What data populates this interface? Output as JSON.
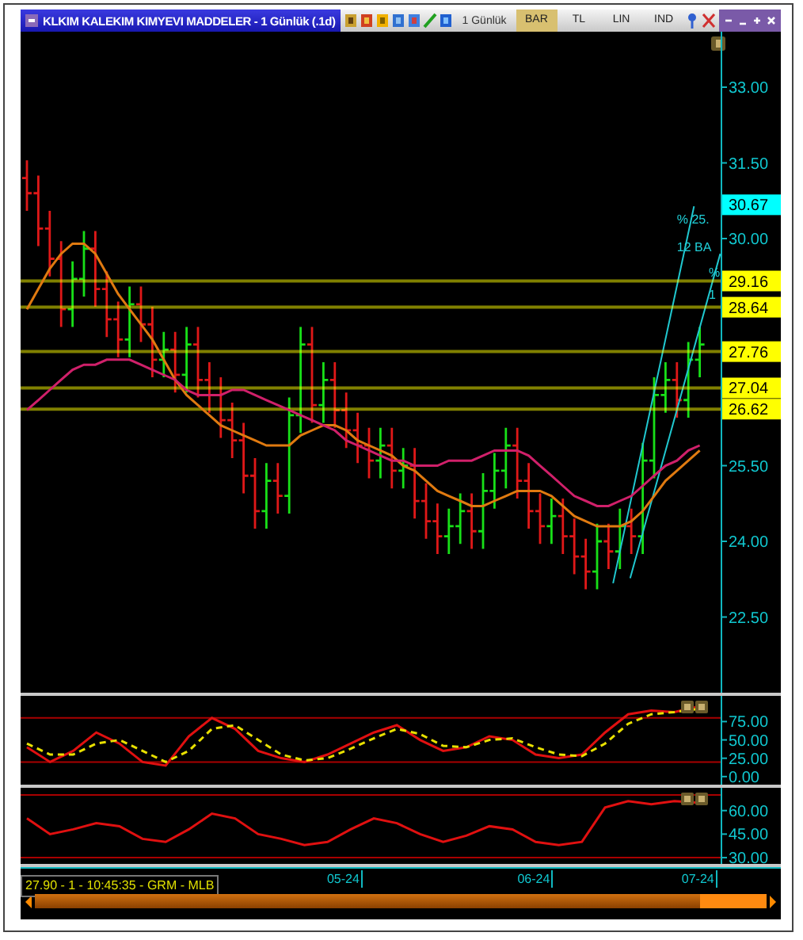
{
  "window": {
    "title": "KLKIM KALEKIM KIMYEVI MADDELER - 1 Günlük (.1d)"
  },
  "toolbar": {
    "period": "1 Günlük",
    "tabs": [
      {
        "label": "BAR",
        "selected": true
      },
      {
        "label": "TL",
        "selected": false
      },
      {
        "label": "LIN",
        "selected": false
      },
      {
        "label": "IND",
        "selected": false
      }
    ]
  },
  "price_panel": {
    "price_tag": "30.67",
    "chart_data": {
      "type": "line",
      "ylim": [
        21,
        34.1
      ],
      "yticks": [
        {
          "value": 22.5,
          "label": "22.50"
        },
        {
          "value": 24,
          "label": "24.00"
        },
        {
          "value": 25.5,
          "label": "25.50"
        },
        {
          "value": 30,
          "label": "30.00"
        },
        {
          "value": 31.5,
          "label": "31.50"
        },
        {
          "value": 33,
          "label": "33.00"
        }
      ],
      "series": [
        {
          "color": "#e07a10",
          "values": [
            28.6,
            29.0,
            29.4,
            29.7,
            29.9,
            29.9,
            29.7,
            29.3,
            28.9,
            28.6,
            28.3,
            28.0,
            27.6,
            27.2,
            26.9,
            26.7,
            26.5,
            26.3,
            26.2,
            26.1,
            26.0,
            25.9,
            25.9,
            25.9,
            26.1,
            26.2,
            26.3,
            26.3,
            26.2,
            26.0,
            25.9,
            25.8,
            25.7,
            25.5,
            25.4,
            25.2,
            25.0,
            24.9,
            24.8,
            24.7,
            24.7,
            24.8,
            24.9,
            25.0,
            25.0,
            25.0,
            24.9,
            24.7,
            24.5,
            24.4,
            24.3,
            24.3,
            24.3,
            24.4,
            24.6,
            24.9,
            25.2,
            25.4,
            25.6,
            25.8
          ]
        },
        {
          "color": "#d0206a",
          "values": [
            26.6,
            26.8,
            27.0,
            27.2,
            27.4,
            27.5,
            27.5,
            27.6,
            27.6,
            27.6,
            27.5,
            27.4,
            27.3,
            27.2,
            27.0,
            26.9,
            26.9,
            26.9,
            27.0,
            27.0,
            26.9,
            26.8,
            26.7,
            26.6,
            26.5,
            26.4,
            26.3,
            26.2,
            26.0,
            25.9,
            25.8,
            25.7,
            25.6,
            25.6,
            25.5,
            25.5,
            25.5,
            25.6,
            25.6,
            25.6,
            25.7,
            25.8,
            25.8,
            25.8,
            25.7,
            25.5,
            25.3,
            25.1,
            24.9,
            24.8,
            24.7,
            24.7,
            24.8,
            24.9,
            25.1,
            25.3,
            25.5,
            25.6,
            25.8,
            25.9
          ]
        }
      ],
      "ref_lines": [
        {
          "axis": "y",
          "value": 29.16,
          "label": "29.16",
          "color": "#ffff00"
        },
        {
          "axis": "y",
          "value": 28.64,
          "label": "28.64",
          "color": "#ffff00"
        },
        {
          "axis": "y",
          "value": 27.76,
          "label": "27.76",
          "color": "#ffff00"
        },
        {
          "axis": "y",
          "value": 27.04,
          "label": "27.04",
          "color": "#ffff00"
        },
        {
          "axis": "y",
          "value": 26.62,
          "label": "26.62",
          "color": "#ffff00"
        }
      ],
      "annotations": [
        "% 25.",
        "12 BA",
        "%",
        "1"
      ]
    }
  },
  "stochastic_panel": {
    "chart_data": {
      "type": "line",
      "ylim": [
        -11,
        110
      ],
      "yticks": [
        {
          "value": 0,
          "label": "0.00"
        },
        {
          "value": 25,
          "label": "25.00"
        },
        {
          "value": 50,
          "label": "50.00"
        },
        {
          "value": 75,
          "label": "75.00"
        }
      ],
      "series": [
        {
          "color": "#e01010",
          "values": [
            40,
            20,
            35,
            60,
            45,
            20,
            15,
            55,
            80,
            65,
            35,
            25,
            20,
            30,
            45,
            60,
            70,
            50,
            35,
            40,
            55,
            50,
            30,
            25,
            30,
            60,
            85,
            90,
            88,
            95
          ]
        },
        {
          "color": "#e8e000",
          "line_style": "dashed",
          "values": [
            45,
            30,
            30,
            45,
            50,
            35,
            20,
            35,
            65,
            70,
            50,
            30,
            22,
            25,
            38,
            52,
            65,
            58,
            42,
            40,
            50,
            52,
            40,
            30,
            28,
            45,
            72,
            85,
            88,
            92
          ]
        }
      ],
      "ref_lines": [
        {
          "axis": "y",
          "value": 80,
          "color": "#a80000"
        },
        {
          "axis": "y",
          "value": 20,
          "color": "#a80000"
        }
      ]
    }
  },
  "rsi_panel": {
    "chart_data": {
      "type": "line",
      "ylim": [
        26,
        74.5
      ],
      "yticks": [
        {
          "value": 30,
          "label": "30.00"
        },
        {
          "value": 45,
          "label": "45.00"
        },
        {
          "value": 60,
          "label": "60.00"
        }
      ],
      "series": [
        {
          "color": "#e01010",
          "values": [
            55,
            45,
            48,
            52,
            50,
            42,
            40,
            48,
            58,
            55,
            45,
            42,
            38,
            40,
            48,
            55,
            52,
            45,
            40,
            44,
            50,
            48,
            40,
            38,
            40,
            62,
            66,
            64,
            66,
            65
          ]
        }
      ],
      "ref_lines": [
        {
          "axis": "y",
          "value": 70,
          "color": "#a80000"
        },
        {
          "axis": "y",
          "value": 30,
          "color": "#a80000"
        }
      ]
    }
  },
  "time_axis": {
    "labels": [
      "05-24",
      "06-24",
      "07-24"
    ]
  },
  "status": "27.90 - 1 - 10:45:35 - GRM - MLB"
}
